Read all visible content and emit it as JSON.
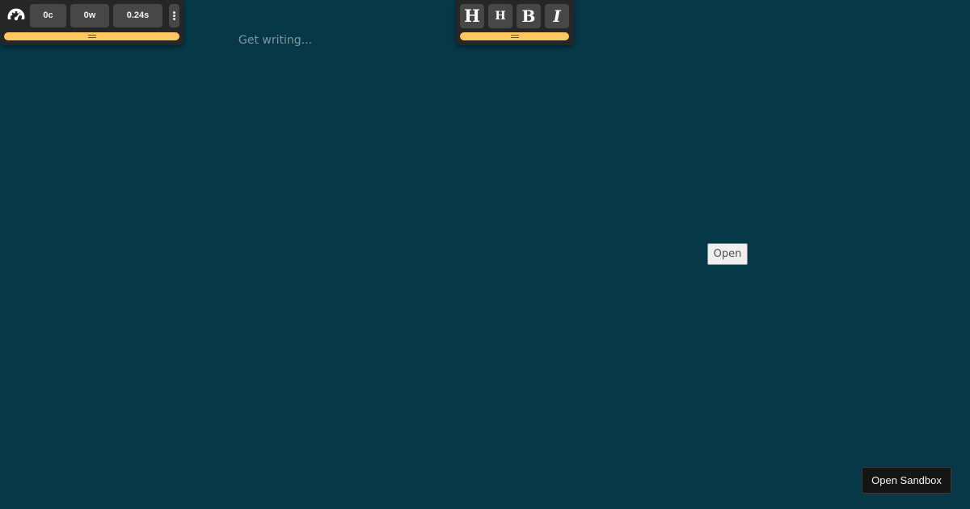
{
  "stats_toolbar": {
    "gauge_icon": "speedometer-icon",
    "characters": "0c",
    "words": "0w",
    "time": "0.24s",
    "more_icon": "vertical-ellipsis-icon",
    "handle_icon": "grip-lines-icon",
    "accent_color": "#ffc761"
  },
  "format_toolbar": {
    "heading1_label": "H",
    "heading2_label": "H",
    "bold_label": "B",
    "italic_label": "I",
    "handle_icon": "grip-lines-icon"
  },
  "editor": {
    "placeholder": "Get writing..."
  },
  "open_button": {
    "label": "Open"
  },
  "sandbox_button": {
    "label": "Open Sandbox"
  },
  "colors": {
    "background": "#073848",
    "toolbar": "#262626",
    "chip": "#474747",
    "handle": "#ffc761"
  }
}
